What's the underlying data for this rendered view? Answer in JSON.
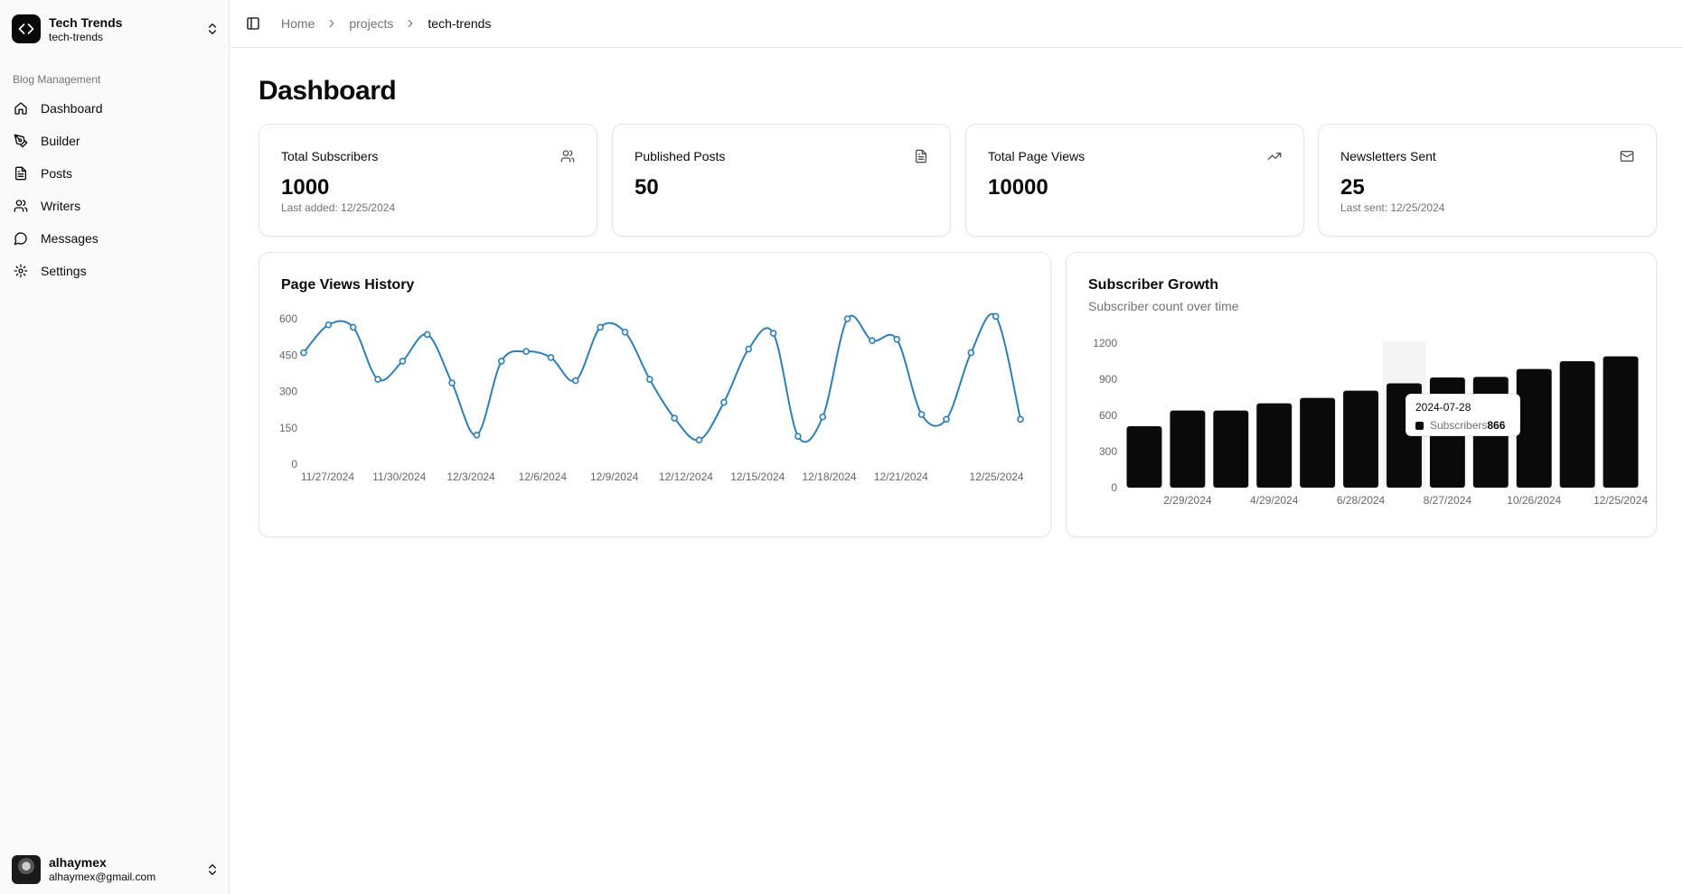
{
  "team": {
    "name": "Tech Trends",
    "slug": "tech-trends"
  },
  "sidebar": {
    "group_label": "Blog Management",
    "items": [
      {
        "label": "Dashboard",
        "icon": "home-icon"
      },
      {
        "label": "Builder",
        "icon": "pen-tool-icon"
      },
      {
        "label": "Posts",
        "icon": "file-text-icon"
      },
      {
        "label": "Writers",
        "icon": "users-icon"
      },
      {
        "label": "Messages",
        "icon": "message-circle-icon"
      },
      {
        "label": "Settings",
        "icon": "gear-icon"
      }
    ]
  },
  "user": {
    "name": "alhaymex",
    "email": "alhaymex@gmail.com"
  },
  "breadcrumb": {
    "home": "Home",
    "section": "projects",
    "current": "tech-trends"
  },
  "page": {
    "title": "Dashboard"
  },
  "stats": [
    {
      "label": "Total Subscribers",
      "value": "1000",
      "sub": "Last added: 12/25/2024",
      "icon": "users-icon"
    },
    {
      "label": "Published Posts",
      "value": "50",
      "sub": "",
      "icon": "file-text-icon"
    },
    {
      "label": "Total Page Views",
      "value": "10000",
      "sub": "",
      "icon": "trending-up-icon"
    },
    {
      "label": "Newsletters Sent",
      "value": "25",
      "sub": "Last sent: 12/25/2024",
      "icon": "mail-icon"
    }
  ],
  "colors": {
    "line": "#2f7fb5",
    "bar": "#0a0a0a",
    "border": "#e5e5e5",
    "muted": "#737373"
  },
  "chart_data": [
    {
      "type": "line",
      "title": "Page Views History",
      "x_tick_labels": [
        "11/27/2024",
        "11/30/2024",
        "12/3/2024",
        "12/6/2024",
        "12/9/2024",
        "12/12/2024",
        "12/15/2024",
        "12/18/2024",
        "12/21/2024",
        "12/25/2024"
      ],
      "x_start": "11/26/2024",
      "x_end": "12/26/2024",
      "values": [
        460,
        575,
        565,
        350,
        425,
        535,
        335,
        120,
        425,
        465,
        440,
        345,
        565,
        545,
        350,
        190,
        100,
        255,
        475,
        540,
        115,
        195,
        600,
        510,
        515,
        205,
        185,
        460,
        610,
        185
      ],
      "ylim": [
        0,
        600
      ],
      "yticks": [
        0,
        150,
        300,
        450,
        600
      ],
      "grid": false
    },
    {
      "type": "bar",
      "title": "Subscriber Growth",
      "subtitle": "Subscriber count over time",
      "series_name": "Subscribers",
      "x_tick_labels": [
        "2/29/2024",
        "4/29/2024",
        "6/28/2024",
        "8/27/2024",
        "10/26/2024",
        "12/25/2024"
      ],
      "values": [
        510,
        640,
        640,
        700,
        745,
        805,
        866,
        915,
        920,
        985,
        1050,
        1090
      ],
      "ylim": [
        0,
        1200
      ],
      "yticks": [
        0,
        300,
        600,
        900,
        1200
      ],
      "grid": false,
      "tooltip": {
        "date": "2024-07-28",
        "label": "Subscribers",
        "value": "866",
        "index": 6
      }
    }
  ]
}
